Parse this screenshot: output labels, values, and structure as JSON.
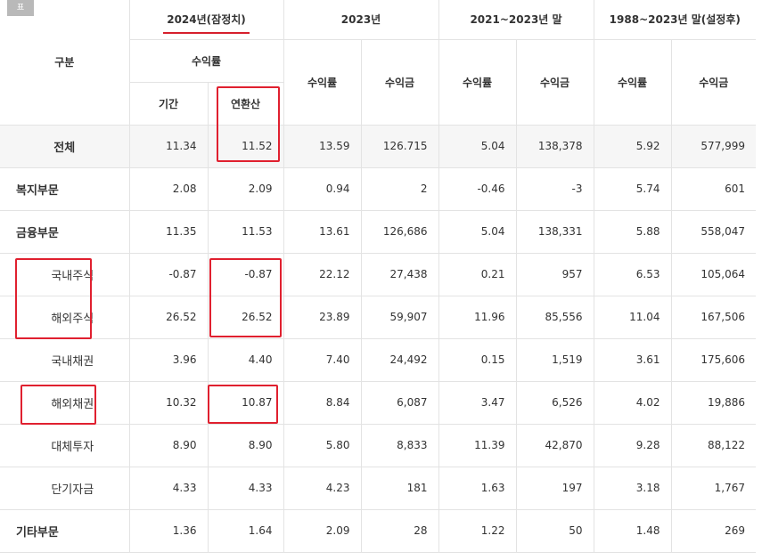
{
  "corner_tag": "표",
  "headers": {
    "category": "구분",
    "year2024": "2024년(잠정치)",
    "year2023": "2023년",
    "range2021": "2021~2023년 말",
    "range1988": "1988~2023년 말(설정후)",
    "rate": "수익률",
    "amount": "수익금",
    "period": "기간",
    "annualized": "연환산"
  },
  "rows": [
    {
      "label": "전체",
      "v": [
        "11.34",
        "11.52",
        "13.59",
        "126.715",
        "5.04",
        "138,378",
        "5.92",
        "577,999"
      ]
    },
    {
      "label": "복지부문",
      "v": [
        "2.08",
        "2.09",
        "0.94",
        "2",
        "-0.46",
        "-3",
        "5.74",
        "601"
      ]
    },
    {
      "label": "금융부문",
      "v": [
        "11.35",
        "11.53",
        "13.61",
        "126,686",
        "5.04",
        "138,331",
        "5.88",
        "558,047"
      ]
    },
    {
      "label": "국내주식",
      "v": [
        "-0.87",
        "-0.87",
        "22.12",
        "27,438",
        "0.21",
        "957",
        "6.53",
        "105,064"
      ]
    },
    {
      "label": "해외주식",
      "v": [
        "26.52",
        "26.52",
        "23.89",
        "59,907",
        "11.96",
        "85,556",
        "11.04",
        "167,506"
      ]
    },
    {
      "label": "국내채권",
      "v": [
        "3.96",
        "4.40",
        "7.40",
        "24,492",
        "0.15",
        "1,519",
        "3.61",
        "175,606"
      ]
    },
    {
      "label": "해외채권",
      "v": [
        "10.32",
        "10.87",
        "8.84",
        "6,087",
        "3.47",
        "6,526",
        "4.02",
        "19,886"
      ]
    },
    {
      "label": "대체투자",
      "v": [
        "8.90",
        "8.90",
        "5.80",
        "8,833",
        "11.39",
        "42,870",
        "9.28",
        "88,122"
      ]
    },
    {
      "label": "단기자금",
      "v": [
        "4.33",
        "4.33",
        "4.23",
        "181",
        "1.63",
        "197",
        "3.18",
        "1,767"
      ]
    },
    {
      "label": "기타부문",
      "v": [
        "1.36",
        "1.64",
        "2.09",
        "28",
        "1.22",
        "50",
        "1.48",
        "269"
      ]
    }
  ]
}
